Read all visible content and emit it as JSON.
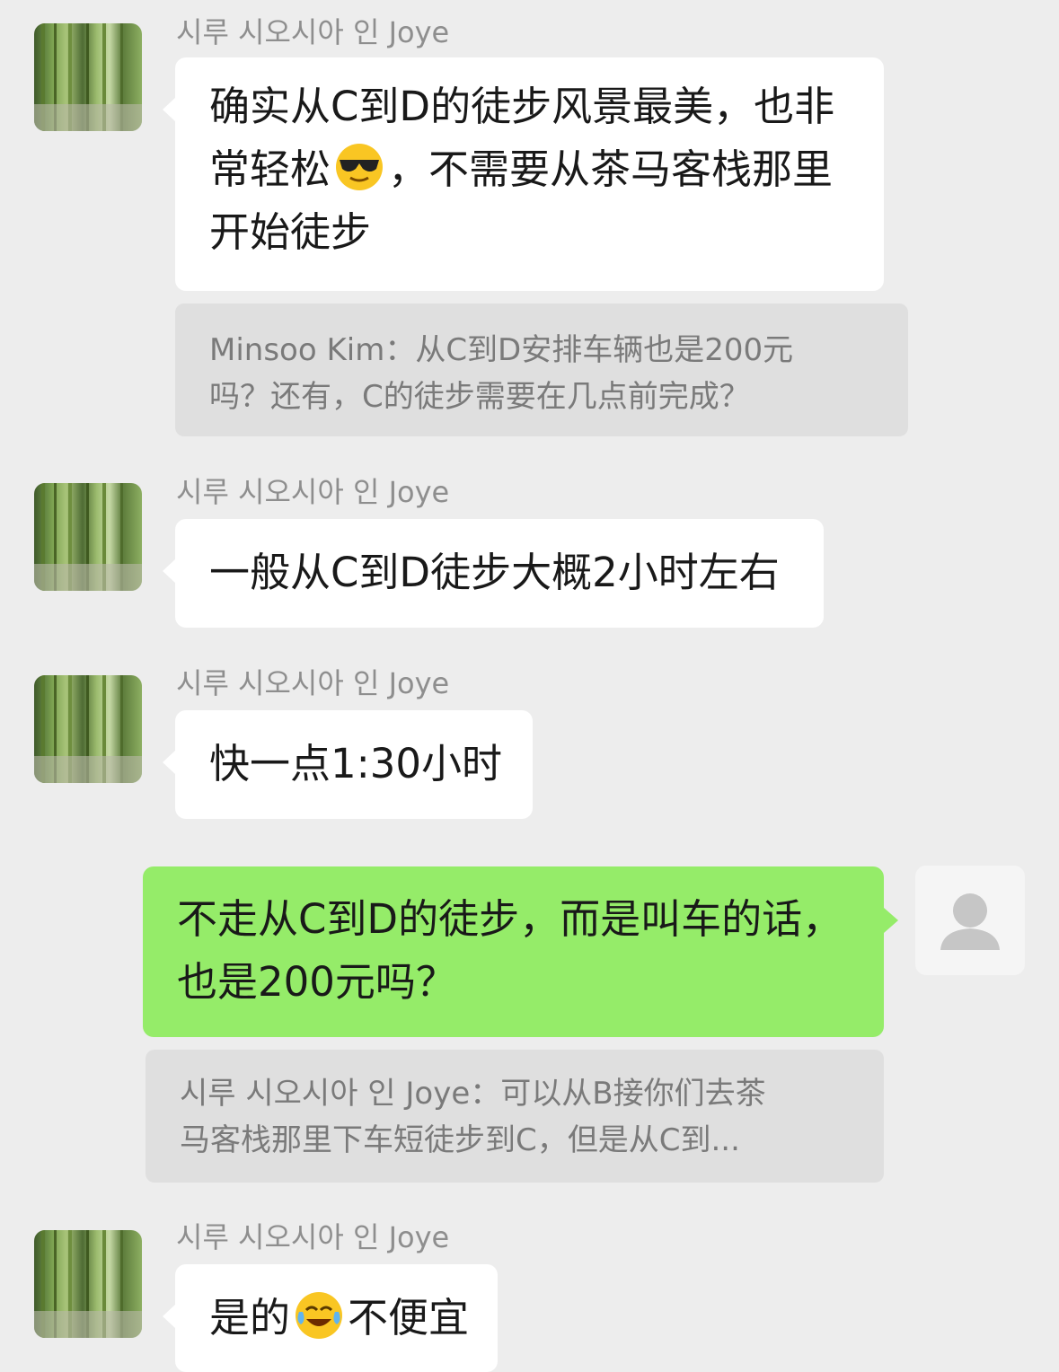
{
  "messages": [
    {
      "sender": "시루 시오시아 인 Joye",
      "line1": "确实从C到D的徒步风景最美，也非",
      "line2a": "常轻松",
      "line2b": "，不需要从茶马客栈那里",
      "line3": "开始徒步",
      "emoji": "sunglasses-emoji"
    },
    {
      "quote_line1": "Minsoo Kim：从C到D安排车辆也是200元",
      "quote_line2": "吗？还有，C的徒步需要在几点前完成？"
    },
    {
      "sender": "시루 시오시아 인 Joye",
      "text": "一般从C到D徒步大概2小时左右"
    },
    {
      "sender": "시루 시오시아 인 Joye",
      "text": "快一点1:30小时"
    },
    {
      "line1": "不走从C到D的徒步，而是叫车的话，",
      "line2": "也是200元吗？"
    },
    {
      "quote_line1": "시루 시오시아 인 Joye：可以从B接你们去茶",
      "quote_line2": "马客栈那里下车短徒步到C，但是从C到..."
    },
    {
      "sender": "시루 시오시아 인 Joye",
      "text_a": "是的",
      "text_b": "不便宜",
      "emoji": "crying-laughing-emoji"
    }
  ],
  "colors": {
    "background": "#ededed",
    "incoming_bubble": "#ffffff",
    "outgoing_bubble": "#95ec69",
    "quote_bg": "#dfdfdf"
  }
}
